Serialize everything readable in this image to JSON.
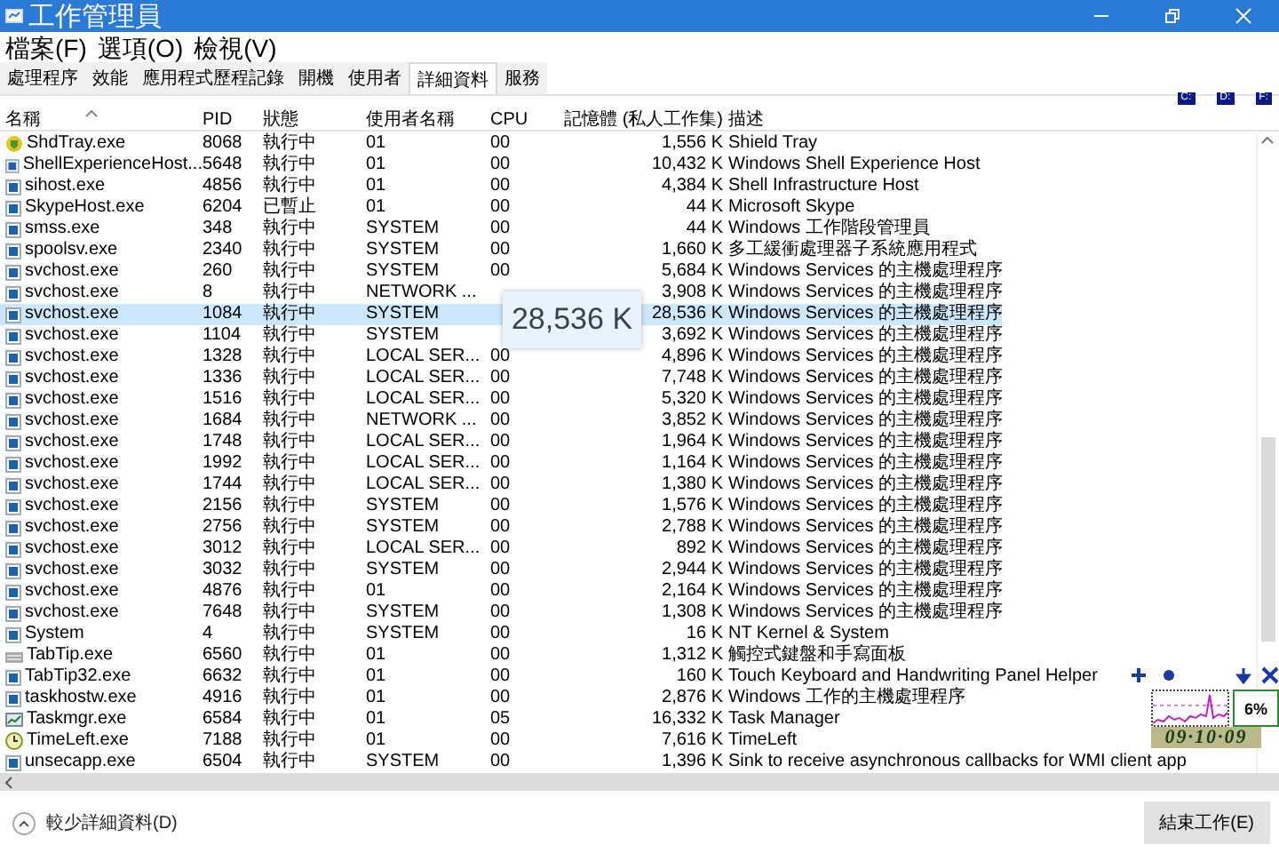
{
  "window": {
    "title": "工作管理員"
  },
  "menu": [
    "檔案(F)",
    "選項(O)",
    "檢視(V)"
  ],
  "tabs": [
    {
      "label": "處理程序",
      "selected": false
    },
    {
      "label": "效能",
      "selected": false
    },
    {
      "label": "應用程式歷程記錄",
      "selected": false
    },
    {
      "label": "開機",
      "selected": false
    },
    {
      "label": "使用者",
      "selected": false
    },
    {
      "label": "詳細資料",
      "selected": true
    },
    {
      "label": "服務",
      "selected": false
    }
  ],
  "drives": [
    "C:",
    "D:",
    "F:"
  ],
  "table": {
    "columns": [
      "名稱",
      "PID",
      "狀態",
      "使用者名稱",
      "CPU",
      "記憶體 (私人工作集)",
      "描述"
    ],
    "rows": [
      {
        "kind": "shield",
        "name": "ShdTray.exe",
        "pid": "8068",
        "status": "執行中",
        "user": "01",
        "cpu": "00",
        "memory": "1,556 K",
        "description": "Shield Tray",
        "selected": false
      },
      {
        "kind": "exe",
        "name": "ShellExperienceHost...",
        "pid": "5648",
        "status": "執行中",
        "user": "01",
        "cpu": "00",
        "memory": "10,432 K",
        "description": "Windows Shell Experience Host",
        "selected": false
      },
      {
        "kind": "exe",
        "name": "sihost.exe",
        "pid": "4856",
        "status": "執行中",
        "user": "01",
        "cpu": "00",
        "memory": "4,384 K",
        "description": "Shell Infrastructure Host",
        "selected": false
      },
      {
        "kind": "exe",
        "name": "SkypeHost.exe",
        "pid": "6204",
        "status": "已暫止",
        "user": "01",
        "cpu": "00",
        "memory": "44 K",
        "description": "Microsoft Skype",
        "selected": false
      },
      {
        "kind": "exe",
        "name": "smss.exe",
        "pid": "348",
        "status": "執行中",
        "user": "SYSTEM",
        "cpu": "00",
        "memory": "44 K",
        "description": "Windows 工作階段管理員",
        "selected": false
      },
      {
        "kind": "exe",
        "name": "spoolsv.exe",
        "pid": "2340",
        "status": "執行中",
        "user": "SYSTEM",
        "cpu": "00",
        "memory": "1,660 K",
        "description": "多工緩衝處理器子系統應用程式",
        "selected": false
      },
      {
        "kind": "exe",
        "name": "svchost.exe",
        "pid": "260",
        "status": "執行中",
        "user": "SYSTEM",
        "cpu": "00",
        "memory": "5,684 K",
        "description": "Windows Services 的主機處理程序",
        "selected": false
      },
      {
        "kind": "exe",
        "name": "svchost.exe",
        "pid": "8",
        "status": "執行中",
        "user": "NETWORK ...",
        "memory": "3,908 K",
        "description": "Windows Services 的主機處理程序",
        "selected": false
      },
      {
        "kind": "exe",
        "name": "svchost.exe",
        "pid": "1084",
        "status": "執行中",
        "user": "SYSTEM",
        "memory": "28,536 K",
        "description": "Windows Services 的主機處理程序",
        "selected": true
      },
      {
        "kind": "exe",
        "name": "svchost.exe",
        "pid": "1104",
        "status": "執行中",
        "user": "SYSTEM",
        "memory": "3,692 K",
        "description": "Windows Services 的主機處理程序",
        "selected": false
      },
      {
        "kind": "exe",
        "name": "svchost.exe",
        "pid": "1328",
        "status": "執行中",
        "user": "LOCAL SER...",
        "cpu": "00",
        "memory": "4,896 K",
        "description": "Windows Services 的主機處理程序",
        "selected": false
      },
      {
        "kind": "exe",
        "name": "svchost.exe",
        "pid": "1336",
        "status": "執行中",
        "user": "LOCAL SER...",
        "cpu": "00",
        "memory": "7,748 K",
        "description": "Windows Services 的主機處理程序",
        "selected": false
      },
      {
        "kind": "exe",
        "name": "svchost.exe",
        "pid": "1516",
        "status": "執行中",
        "user": "LOCAL SER...",
        "cpu": "00",
        "memory": "5,320 K",
        "description": "Windows Services 的主機處理程序",
        "selected": false
      },
      {
        "kind": "exe",
        "name": "svchost.exe",
        "pid": "1684",
        "status": "執行中",
        "user": "NETWORK ...",
        "cpu": "00",
        "memory": "3,852 K",
        "description": "Windows Services 的主機處理程序",
        "selected": false
      },
      {
        "kind": "exe",
        "name": "svchost.exe",
        "pid": "1748",
        "status": "執行中",
        "user": "LOCAL SER...",
        "cpu": "00",
        "memory": "1,964 K",
        "description": "Windows Services 的主機處理程序",
        "selected": false
      },
      {
        "kind": "exe",
        "name": "svchost.exe",
        "pid": "1992",
        "status": "執行中",
        "user": "LOCAL SER...",
        "cpu": "00",
        "memory": "1,164 K",
        "description": "Windows Services 的主機處理程序",
        "selected": false
      },
      {
        "kind": "exe",
        "name": "svchost.exe",
        "pid": "1744",
        "status": "執行中",
        "user": "LOCAL SER...",
        "cpu": "00",
        "memory": "1,380 K",
        "description": "Windows Services 的主機處理程序",
        "selected": false
      },
      {
        "kind": "exe",
        "name": "svchost.exe",
        "pid": "2156",
        "status": "執行中",
        "user": "SYSTEM",
        "cpu": "00",
        "memory": "1,576 K",
        "description": "Windows Services 的主機處理程序",
        "selected": false
      },
      {
        "kind": "exe",
        "name": "svchost.exe",
        "pid": "2756",
        "status": "執行中",
        "user": "SYSTEM",
        "cpu": "00",
        "memory": "2,788 K",
        "description": "Windows Services 的主機處理程序",
        "selected": false
      },
      {
        "kind": "exe",
        "name": "svchost.exe",
        "pid": "3012",
        "status": "執行中",
        "user": "LOCAL SER...",
        "cpu": "00",
        "memory": "892 K",
        "description": "Windows Services 的主機處理程序",
        "selected": false
      },
      {
        "kind": "exe",
        "name": "svchost.exe",
        "pid": "3032",
        "status": "執行中",
        "user": "SYSTEM",
        "cpu": "00",
        "memory": "2,944 K",
        "description": "Windows Services 的主機處理程序",
        "selected": false
      },
      {
        "kind": "exe",
        "name": "svchost.exe",
        "pid": "4876",
        "status": "執行中",
        "user": "01",
        "cpu": "00",
        "memory": "2,164 K",
        "description": "Windows Services 的主機處理程序",
        "selected": false
      },
      {
        "kind": "exe",
        "name": "svchost.exe",
        "pid": "7648",
        "status": "執行中",
        "user": "SYSTEM",
        "cpu": "00",
        "memory": "1,308 K",
        "description": "Windows Services 的主機處理程序",
        "selected": false
      },
      {
        "kind": "exe",
        "name": "System",
        "pid": "4",
        "status": "執行中",
        "user": "SYSTEM",
        "cpu": "00",
        "memory": "16 K",
        "description": "NT Kernel & System",
        "selected": false
      },
      {
        "kind": "keyboard",
        "name": "TabTip.exe",
        "pid": "6560",
        "status": "執行中",
        "user": "01",
        "cpu": "00",
        "memory": "1,312 K",
        "description": "觸控式鍵盤和手寫面板",
        "selected": false
      },
      {
        "kind": "exe",
        "name": "TabTip32.exe",
        "pid": "6632",
        "status": "執行中",
        "user": "01",
        "cpu": "00",
        "memory": "160 K",
        "description": "Touch Keyboard and Handwriting Panel Helper",
        "selected": false
      },
      {
        "kind": "exe",
        "name": "taskhostw.exe",
        "pid": "4916",
        "status": "執行中",
        "user": "01",
        "cpu": "00",
        "memory": "2,876 K",
        "description": "Windows 工作的主機處理程序",
        "selected": false
      },
      {
        "kind": "monitor",
        "name": "Taskmgr.exe",
        "pid": "6584",
        "status": "執行中",
        "user": "01",
        "cpu": "05",
        "memory": "16,332 K",
        "description": "Task Manager",
        "selected": false
      },
      {
        "kind": "clock",
        "name": "TimeLeft.exe",
        "pid": "7188",
        "status": "執行中",
        "user": "01",
        "cpu": "00",
        "memory": "7,616 K",
        "description": "TimeLeft",
        "selected": false
      },
      {
        "kind": "exe",
        "name": "unsecapp.exe",
        "pid": "6504",
        "status": "執行中",
        "user": "SYSTEM",
        "cpu": "00",
        "memory": "1,396 K",
        "description": "Sink to receive asynchronous callbacks for WMI client app",
        "selected": false
      }
    ]
  },
  "magnifier": {
    "text": "28,536 K"
  },
  "gadget": {
    "reading": "6%",
    "clock": "09·10·09"
  },
  "footer": {
    "toggle": "較少詳細資料(D)",
    "end_task": "結束工作(E)"
  }
}
